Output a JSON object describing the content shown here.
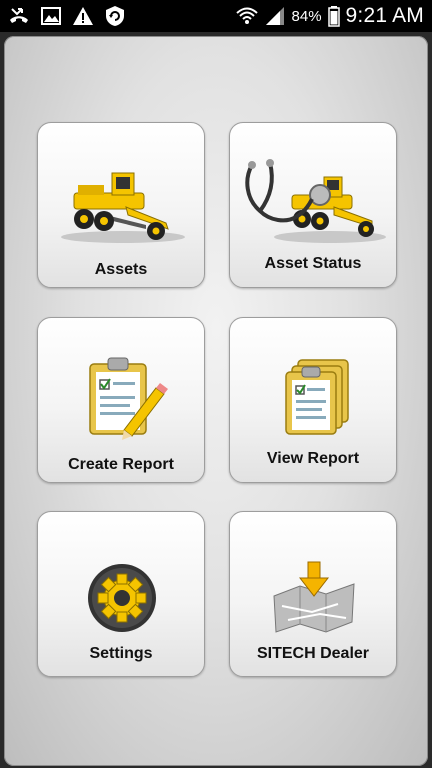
{
  "status_bar": {
    "notification_icons": [
      "missed-call-icon",
      "image-icon",
      "warning-icon",
      "shield-refresh-icon"
    ],
    "wifi_icon": "wifi-icon",
    "signal_icon": "cell-signal-icon",
    "battery_percent": "84%",
    "battery_icon": "battery-icon",
    "time": "9:21 AM"
  },
  "menu": {
    "accent_color": "#f5c400",
    "tiles": [
      {
        "label": "Assets",
        "icon": "grader-icon"
      },
      {
        "label": "Asset Status",
        "icon": "stethoscope-grader-icon"
      },
      {
        "label": "Create Report",
        "icon": "clipboard-pencil-icon"
      },
      {
        "label": "View Report",
        "icon": "clipboard-stack-icon"
      },
      {
        "label": "Settings",
        "icon": "gear-icon"
      },
      {
        "label": "SITECH Dealer",
        "icon": "map-pin-icon"
      }
    ]
  }
}
